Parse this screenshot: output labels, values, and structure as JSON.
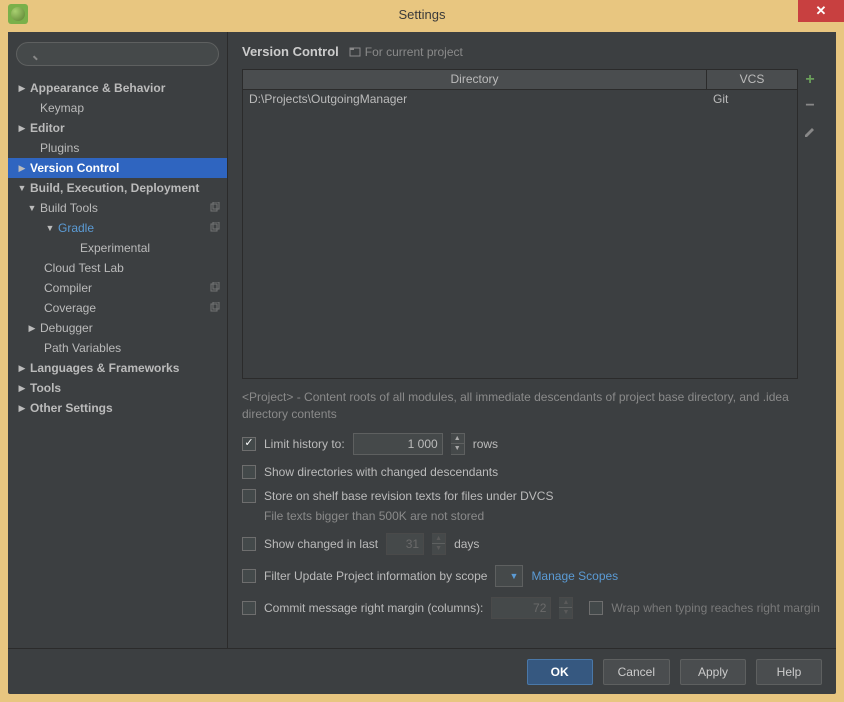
{
  "window": {
    "title": "Settings"
  },
  "header": {
    "title": "Version Control",
    "subtitle": "For current project"
  },
  "sidebar": {
    "search_placeholder": "",
    "items": [
      {
        "label": "Appearance & Behavior"
      },
      {
        "label": "Keymap"
      },
      {
        "label": "Editor"
      },
      {
        "label": "Plugins"
      },
      {
        "label": "Version Control"
      },
      {
        "label": "Build, Execution, Deployment"
      },
      {
        "label": "Build Tools"
      },
      {
        "label": "Gradle"
      },
      {
        "label": "Experimental"
      },
      {
        "label": "Cloud Test Lab"
      },
      {
        "label": "Compiler"
      },
      {
        "label": "Coverage"
      },
      {
        "label": "Debugger"
      },
      {
        "label": "Path Variables"
      },
      {
        "label": "Languages & Frameworks"
      },
      {
        "label": "Tools"
      },
      {
        "label": "Other Settings"
      }
    ]
  },
  "table": {
    "headers": {
      "directory": "Directory",
      "vcs": "VCS"
    },
    "rows": [
      {
        "directory": "D:\\Projects\\OutgoingManager",
        "vcs": "Git"
      }
    ]
  },
  "hint": "<Project> - Content roots of all modules, all immediate descendants of project base directory, and .idea directory contents",
  "options": {
    "limit_history_label": "Limit history to:",
    "limit_history_value": "1 000",
    "limit_history_unit": "rows",
    "show_dirs_label": "Show directories with changed descendants",
    "store_shelf_label": "Store on shelf base revision texts for files under DVCS",
    "store_shelf_hint": "File texts bigger than 500K are not stored",
    "show_changed_label": "Show changed in last",
    "show_changed_value": "31",
    "show_changed_unit": "days",
    "filter_scope_label": "Filter Update Project information by scope",
    "manage_scopes": "Manage Scopes",
    "commit_margin_label": "Commit message right margin (columns):",
    "commit_margin_value": "72",
    "wrap_label": "Wrap when typing reaches right margin"
  },
  "footer": {
    "ok": "OK",
    "cancel": "Cancel",
    "apply": "Apply",
    "help": "Help"
  }
}
